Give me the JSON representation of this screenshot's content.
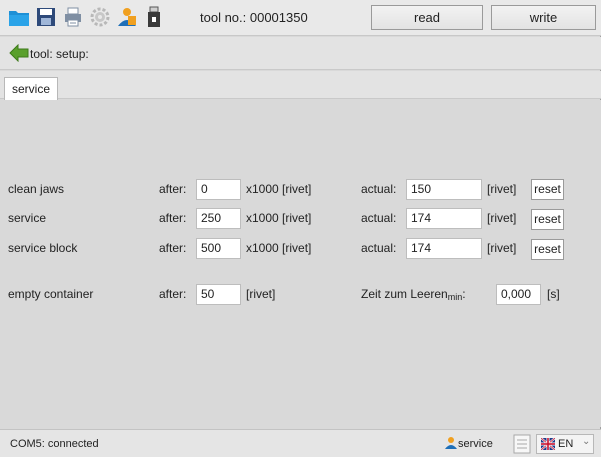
{
  "toolbar": {
    "icons": [
      "folder-icon",
      "save-icon",
      "printer-icon",
      "gear-icon",
      "user-icon",
      "usb-drive-icon"
    ],
    "tool_no_label": "tool no.: 00001350",
    "read_label": "read",
    "write_label": "write"
  },
  "breadcrumb": {
    "text": "tool: setup:"
  },
  "tabs": [
    {
      "label": "service",
      "active": true
    }
  ],
  "rows": [
    {
      "name": "clean jaws",
      "after_label": "after:",
      "after_value": "0",
      "after_unit": "x1000 [rivet]",
      "actual_label": "actual:",
      "actual_value": "150",
      "actual_unit": "[rivet]",
      "reset_label": "reset"
    },
    {
      "name": "service",
      "after_label": "after:",
      "after_value": "250",
      "after_unit": "x1000 [rivet]",
      "actual_label": "actual:",
      "actual_value": "174",
      "actual_unit": "[rivet]",
      "reset_label": "reset"
    },
    {
      "name": "service block",
      "after_label": "after:",
      "after_value": "500",
      "after_unit": "x1000 [rivet]",
      "actual_label": "actual:",
      "actual_value": "174",
      "actual_unit": "[rivet]",
      "reset_label": "reset"
    }
  ],
  "container": {
    "name": "empty container",
    "after_label": "after:",
    "after_value": "50",
    "after_unit": "[rivet]",
    "time_label": "Zeit zum Leeren",
    "time_sub": "min",
    "time_label_suffix": ":",
    "time_value": "0,000",
    "time_unit": "[s]"
  },
  "status": {
    "connection": "COM5: connected",
    "user_label": "service",
    "language": "EN"
  },
  "colors": {
    "accent_green": "#5aa02c",
    "folder_blue": "#1e90d6",
    "user_orange": "#f0a020"
  }
}
